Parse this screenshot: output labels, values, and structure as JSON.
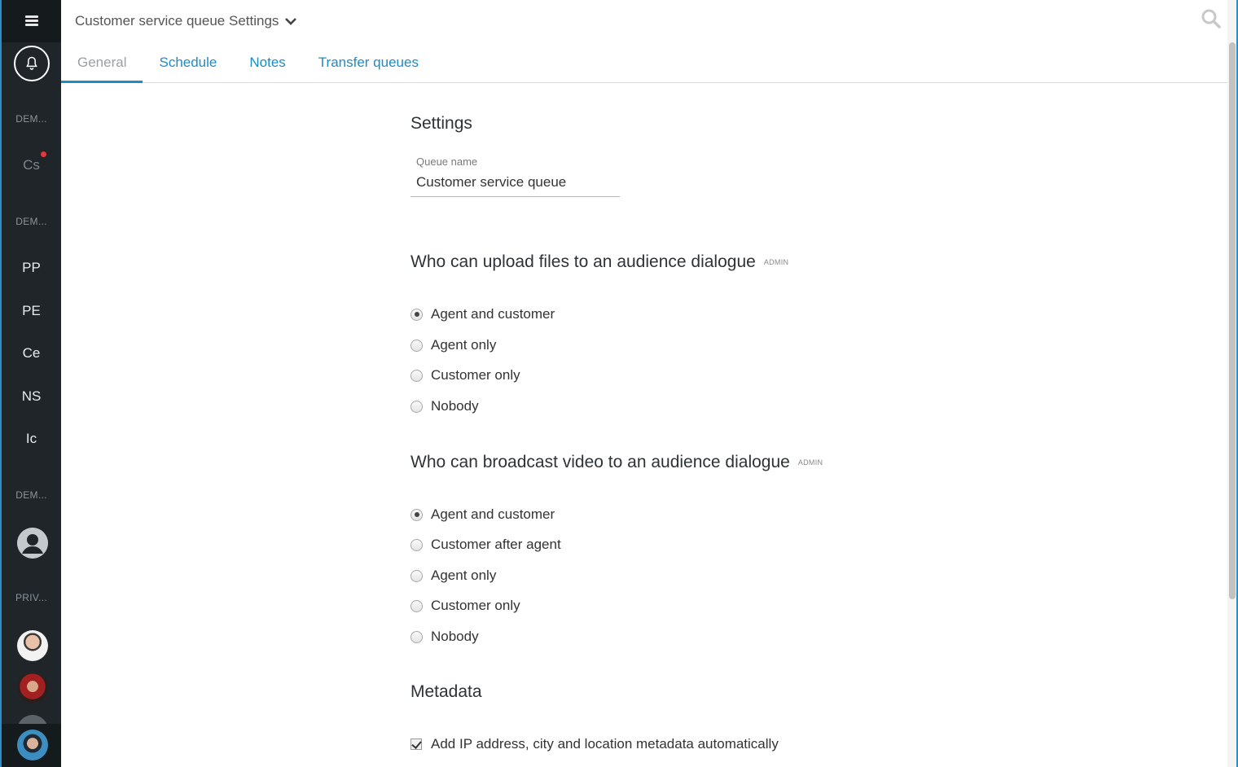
{
  "header": {
    "title": "Customer service queue Settings",
    "tabs": [
      {
        "label": "General",
        "active": true
      },
      {
        "label": "Schedule",
        "active": false
      },
      {
        "label": "Notes",
        "active": false
      },
      {
        "label": "Transfer queues",
        "active": false
      }
    ]
  },
  "sidebar": {
    "sections": [
      "DEM...",
      "DEM...",
      "DEM...",
      "PRIV..."
    ],
    "items": [
      "Cs",
      "PP",
      "PE",
      "Ce",
      "NS",
      "Ic"
    ]
  },
  "settings": {
    "heading": "Settings",
    "queue_name_label": "Queue name",
    "queue_name_value": "Customer service queue"
  },
  "upload": {
    "heading": "Who can upload files to an audience dialogue",
    "badge": "ADMIN",
    "options": [
      "Agent and customer",
      "Agent only",
      "Customer only",
      "Nobody"
    ],
    "selected": "Agent and customer"
  },
  "video": {
    "heading": "Who can broadcast video to an audience dialogue",
    "badge": "ADMIN",
    "options": [
      "Agent and customer",
      "Customer after agent",
      "Agent only",
      "Customer only",
      "Nobody"
    ],
    "selected": "Agent and customer"
  },
  "metadata": {
    "heading": "Metadata",
    "checkbox_label": "Add IP address, city and location metadata automatically",
    "checked": true
  },
  "colors": {
    "accent": "#1e8cc4",
    "sidebar_bg": "#1f2529",
    "notification_dot": "#e0393e"
  }
}
